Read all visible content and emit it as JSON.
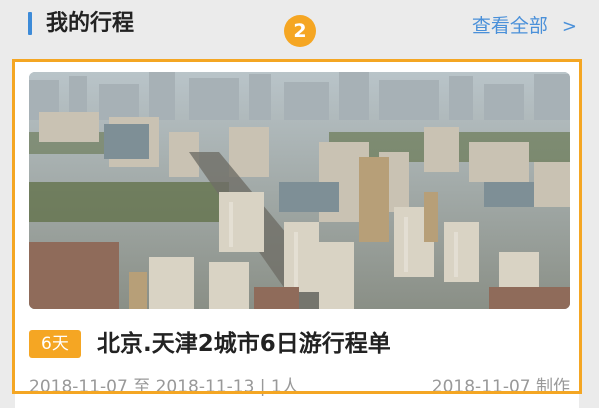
{
  "section": {
    "title": "我的行程",
    "view_all_label": "查看全部",
    "view_all_chevron": ">",
    "step_number": "2"
  },
  "trip_card": {
    "image_icon": "city-skyline-photo",
    "days_badge": "6天",
    "title": "北京.天津2城市6日游行程单",
    "date_range": "2018-11-07 至 2018-11-13 | 1人",
    "created": "2018-11-07 制作"
  },
  "colors": {
    "accent_blue": "#3d8bd8",
    "link_blue": "#4a90d9",
    "highlight_orange": "#f4a623",
    "badge_orange": "#f5a623"
  }
}
